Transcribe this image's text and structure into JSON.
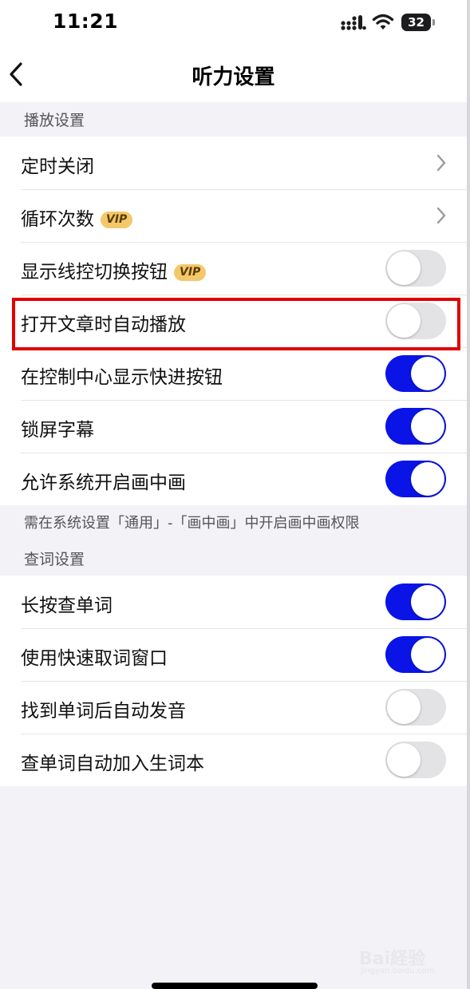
{
  "status_bar": {
    "time": "11:21",
    "battery": "32"
  },
  "nav": {
    "title": "听力设置"
  },
  "playback_section": {
    "header": "播放设置",
    "items": [
      {
        "label": "定时关闭",
        "control": "chevron"
      },
      {
        "label": "循环次数",
        "vip": "VIP",
        "control": "chevron"
      },
      {
        "label": "显示线控切换按钮",
        "vip": "VIP",
        "control": "toggle",
        "on": false
      },
      {
        "label": "打开文章时自动播放",
        "control": "toggle",
        "on": false
      },
      {
        "label": "在控制中心显示快进按钮",
        "control": "toggle",
        "on": true
      },
      {
        "label": "锁屏字幕",
        "control": "toggle",
        "on": true
      },
      {
        "label": "允许系统开启画中画",
        "control": "toggle",
        "on": true
      }
    ],
    "footnote": "需在系统设置「通用」-「画中画」中开启画中画权限"
  },
  "lookup_section": {
    "header": "查词设置",
    "items": [
      {
        "label": "长按查单词",
        "control": "toggle",
        "on": true
      },
      {
        "label": "使用快速取词窗口",
        "control": "toggle",
        "on": true
      },
      {
        "label": "找到单词后自动发音",
        "control": "toggle",
        "on": false
      },
      {
        "label": "查单词自动加入生词本",
        "control": "toggle",
        "on": false
      }
    ]
  },
  "colors": {
    "toggle_on": "#0a14e6",
    "toggle_off": "#e3e3e6",
    "highlight": "#e00000",
    "vip_badge": "#f3c86a"
  },
  "watermark": {
    "text": "Bai経验",
    "sub": "jingyan.baidu.com"
  }
}
